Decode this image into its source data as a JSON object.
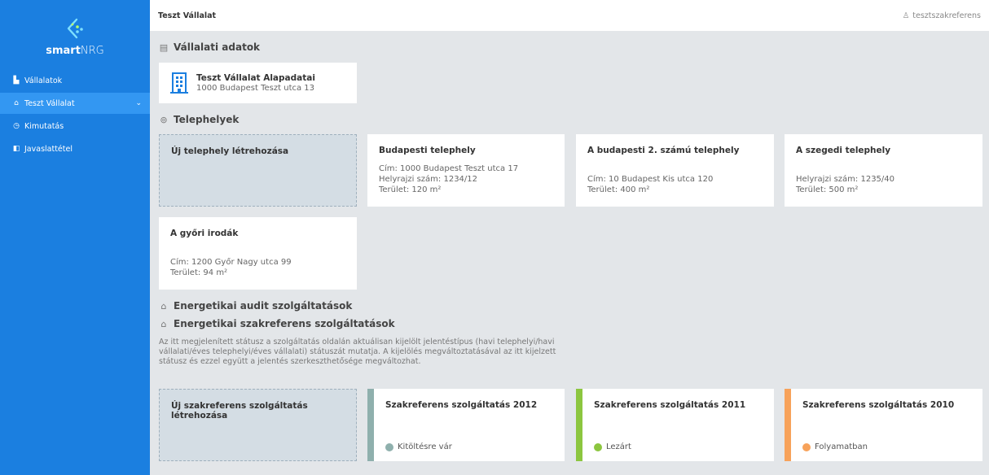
{
  "sidebar": {
    "logo_text_bold": "smart",
    "logo_text_light": "NRG",
    "items": [
      {
        "label": "Vállalatok",
        "icon": "building-icon"
      },
      {
        "label": "Teszt Vállalat",
        "icon": "briefcase-icon"
      },
      {
        "label": "Kimutatás",
        "icon": "clock-icon"
      },
      {
        "label": "Javaslattétel",
        "icon": "book-icon"
      }
    ]
  },
  "topbar": {
    "company": "Teszt Vállalat",
    "user": "tesztszakreferens"
  },
  "sections": {
    "company_data": "Vállalati adatok",
    "sites": "Telephelyek",
    "audit": "Energetikai audit szolgáltatások",
    "referens": "Energetikai szakreferens szolgáltatások"
  },
  "company_card": {
    "title": "Teszt Vállalat Alapadatai",
    "address": "1000 Budapest Teszt utca 13"
  },
  "sites": {
    "new_label": "Új telephely létrehozása",
    "items": [
      {
        "title": "Budapesti telephely",
        "l1": "Cím: 1000 Budapest Teszt utca 17",
        "l2": "Helyrajzi szám: 1234/12",
        "l3": "Terület: 120 m²"
      },
      {
        "title": "A budapesti 2. számú telephely",
        "l1": "",
        "l2": "Cím: 10 Budapest Kis utca 120",
        "l3": "Terület: 400 m²"
      },
      {
        "title": "A szegedi telephely",
        "l1": "",
        "l2": "Helyrajzi szám: 1235/40",
        "l3": "Terület: 500 m²"
      },
      {
        "title": "A győri irodák",
        "l1": "",
        "l2": "Cím: 1200 Győr Nagy utca 99",
        "l3": "Terület: 94 m²"
      }
    ]
  },
  "description": "Az itt megjelenített státusz a szolgáltatás oldalán aktuálisan kijelölt jelentéstípus (havi telephelyi/havi vállalati/éves telephelyi/éves vállalati) státuszát mutatja. A kijelölés megváltoztatásával az itt kijelzett státusz és ezzel együtt a jelentés szerkeszthetősége megváltozhat.",
  "referens": {
    "new_label": "Új szakreferens szolgáltatás létrehozása",
    "items": [
      {
        "title": "Szakreferens szolgáltatás 2012",
        "status": "Kitöltésre vár",
        "color": "#8fb0ad"
      },
      {
        "title": "Szakreferens szolgáltatás 2011",
        "status": "Lezárt",
        "color": "#8cc63f"
      },
      {
        "title": "Szakreferens szolgáltatás 2010",
        "status": "Folyamatban",
        "color": "#f7a25a"
      }
    ]
  },
  "colors": {
    "sidebar": "#1b7fe0",
    "sidebar_active": "#3397f2",
    "background": "#e3e6e9",
    "building_icon": "#1b7fe0"
  }
}
